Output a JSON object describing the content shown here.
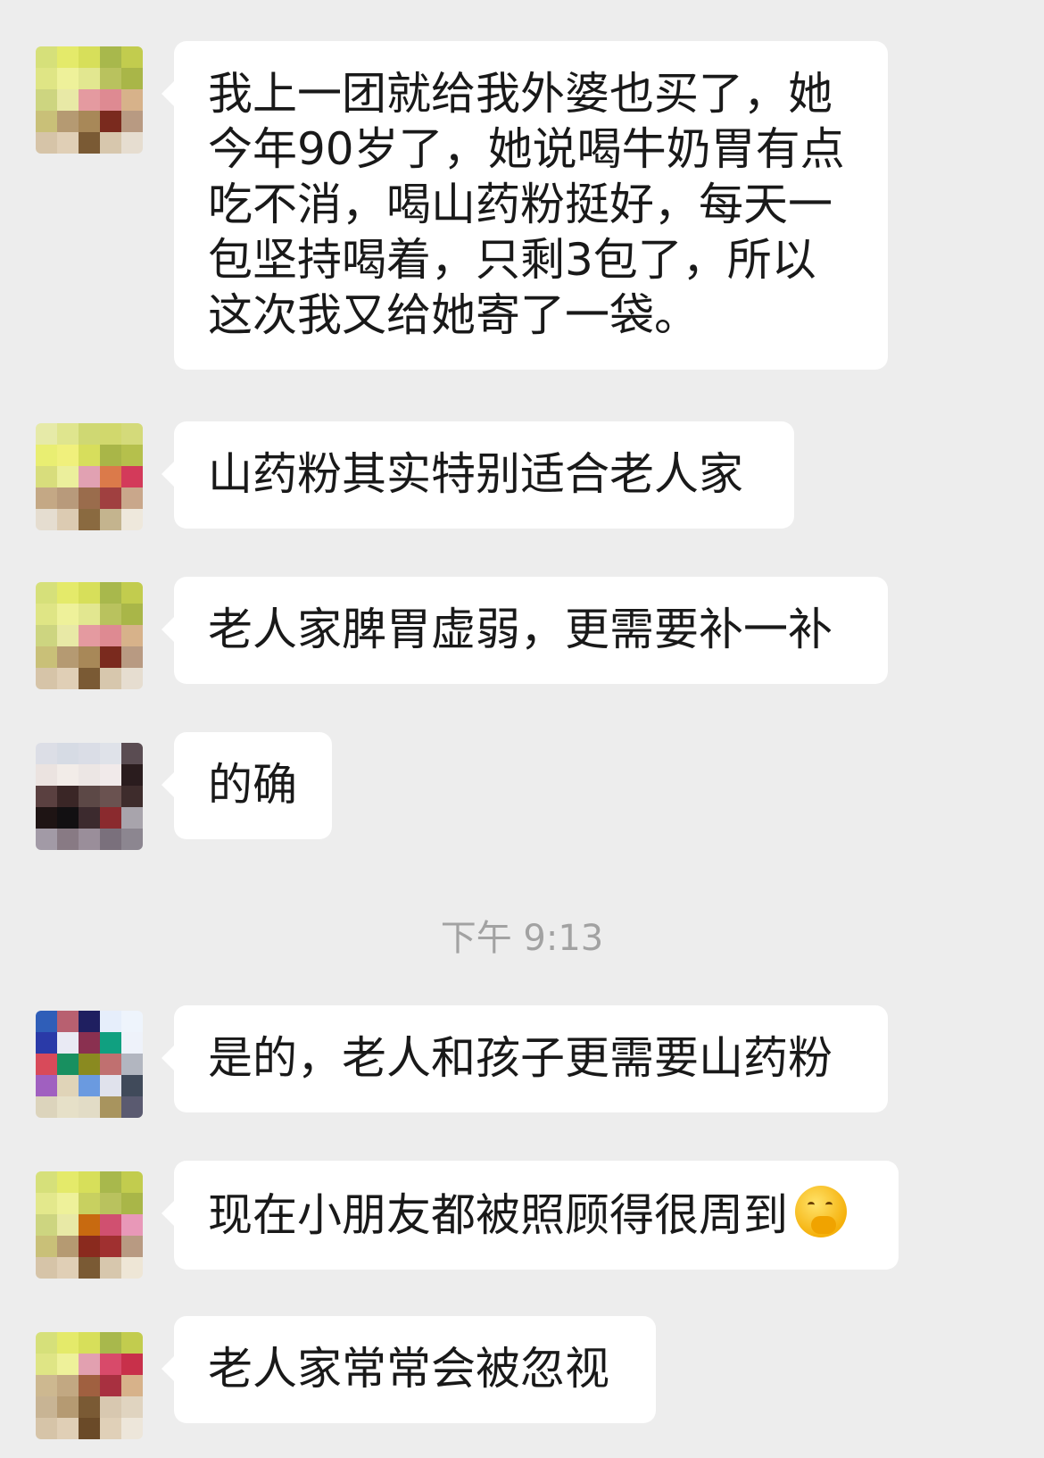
{
  "chat": {
    "messages": [
      {
        "text": "我上一团就给我外婆也买了，她今年90岁了，她说喝牛奶胃有点吃不消，喝山药粉挺好，每天一包坚持喝着，只剩3包了，所以这次我又给她寄了一袋。"
      },
      {
        "text": "山药粉其实特别适合老人家"
      },
      {
        "text": "老人家脾胃虚弱，更需要补一补"
      },
      {
        "text": "的确"
      },
      {
        "text": "是的，老人和孩子更需要山药粉"
      },
      {
        "text": "现在小朋友都被照顾得很周到",
        "emoji": "thinking-face-emoji"
      },
      {
        "text": "老人家常常会被忽视"
      }
    ],
    "timestamp": "下午 9:13"
  },
  "colors": {
    "background": "#ededed",
    "bubble": "#ffffff",
    "text": "#191919",
    "timestamp": "#a2a2a2"
  }
}
